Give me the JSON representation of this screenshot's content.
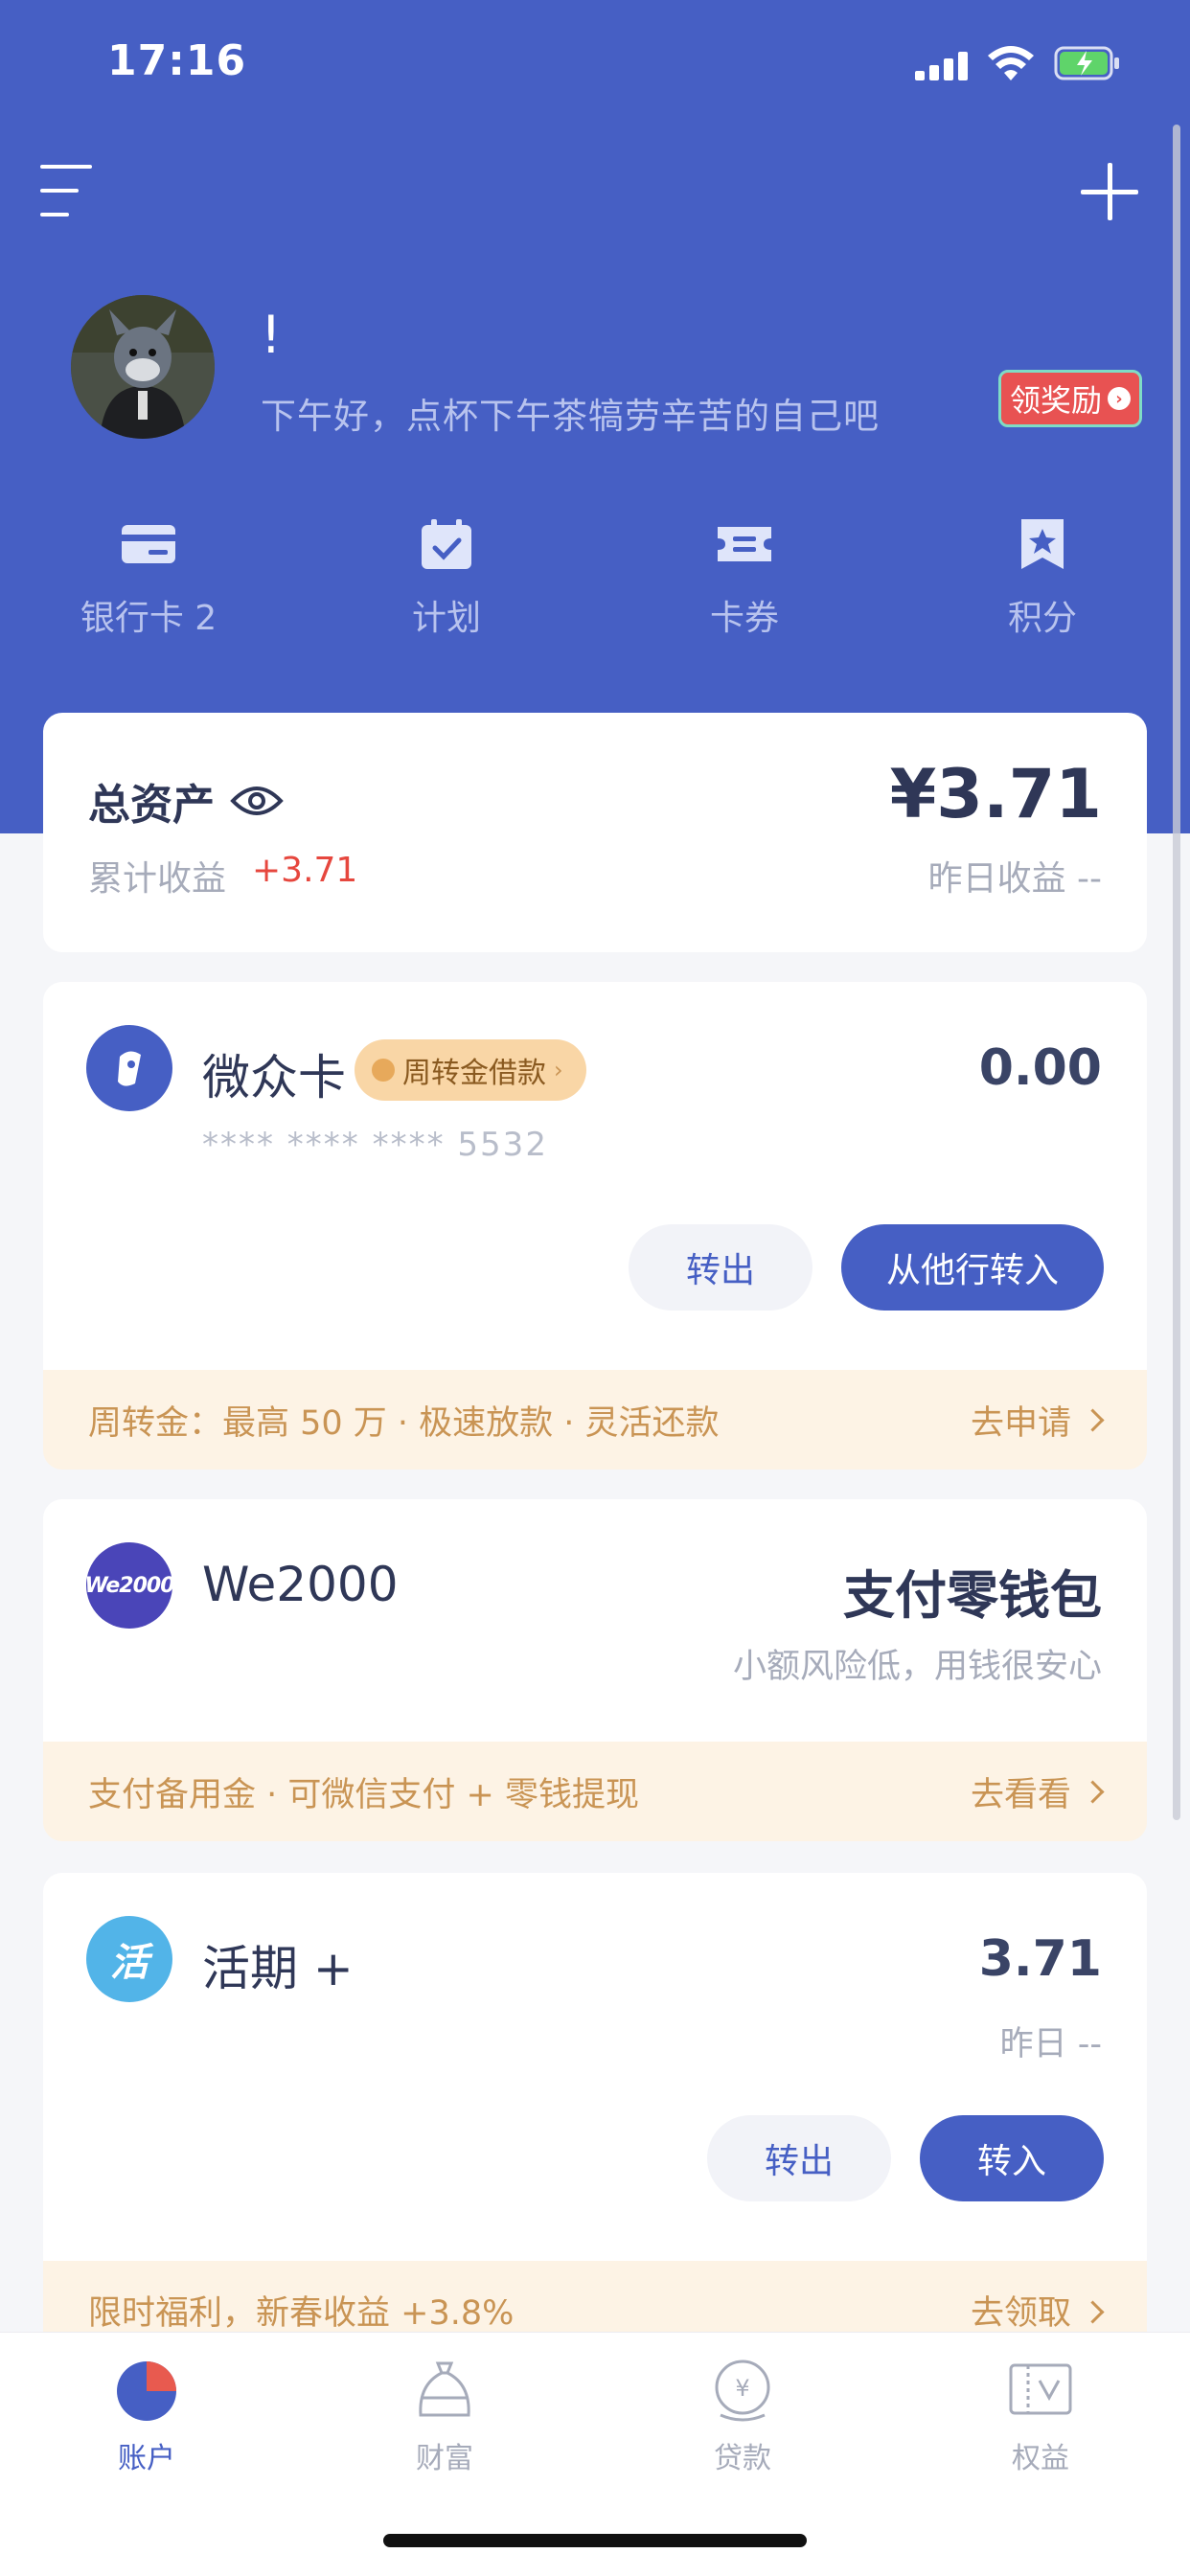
{
  "status_bar": {
    "time": "17:16"
  },
  "header": {
    "name": "!",
    "greeting": "下午好，点杯下午茶犒劳辛苦的自己吧",
    "reward_button": "领奖励"
  },
  "quick_actions": [
    {
      "label": "银行卡 2",
      "icon": "bank-card-icon"
    },
    {
      "label": "计划",
      "icon": "calendar-check-icon"
    },
    {
      "label": "卡券",
      "icon": "ticket-icon"
    },
    {
      "label": "积分",
      "icon": "bookmark-star-icon"
    }
  ],
  "assets": {
    "title": "总资产",
    "amount": "¥3.71",
    "cumulative_label": "累计收益",
    "cumulative_value": "+3.71",
    "yesterday_label": "昨日收益  --"
  },
  "weizhong_card": {
    "name": "微众卡",
    "tag": "周转金借款",
    "balance": "0.00",
    "card_number": "**** **** **** 5532",
    "transfer_out": "转出",
    "transfer_in": "从他行转入",
    "promo_text": "周转金：最高 50 万 · 极速放款 · 灵活还款",
    "promo_action": "去申请"
  },
  "we2000": {
    "icon_text": "We2000",
    "name": "We2000",
    "title": "支付零钱包",
    "subtitle": "小额风险低，用钱很安心",
    "promo_text": "支付备用金 · 可微信支付 + 零钱提现",
    "promo_action": "去看看"
  },
  "huoqi": {
    "icon_text": "活",
    "name": "活期 +",
    "balance": "3.71",
    "yesterday": "昨日  --",
    "transfer_out": "转出",
    "transfer_in": "转入",
    "promo_text": "限时福利，新春收益 +3.8%",
    "promo_action": "去领取"
  },
  "tabs": [
    {
      "label": "账户",
      "active": true
    },
    {
      "label": "财富",
      "active": false
    },
    {
      "label": "贷款",
      "active": false
    },
    {
      "label": "权益",
      "active": false
    }
  ],
  "colors": {
    "brand": "#465fc4",
    "accent_red": "#e6473e",
    "promo_text": "#c99454"
  }
}
